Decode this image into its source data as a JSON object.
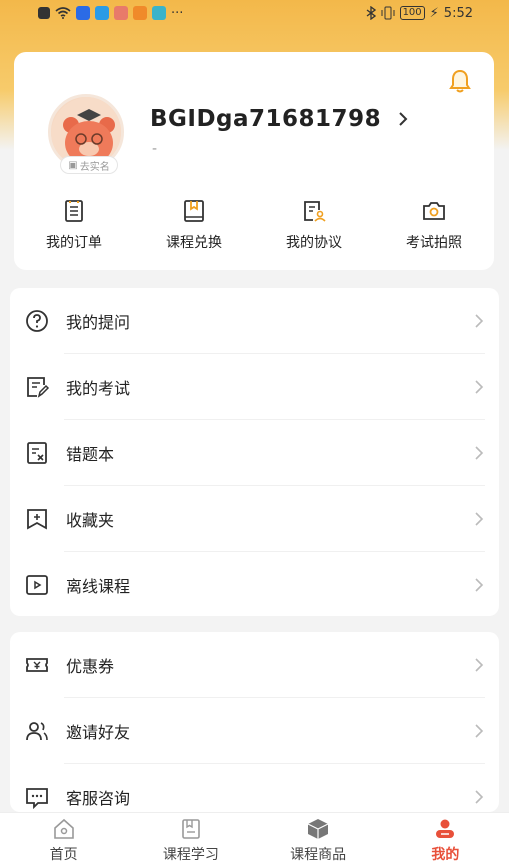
{
  "status_bar": {
    "time": "5:52",
    "battery": "100"
  },
  "profile": {
    "username": "BGIDga71681798",
    "subtitle": "-",
    "auth_badge": "去实名"
  },
  "quick_actions": [
    {
      "label": "我的订单",
      "icon": "order-icon"
    },
    {
      "label": "课程兑换",
      "icon": "book-icon"
    },
    {
      "label": "我的协议",
      "icon": "agreement-icon"
    },
    {
      "label": "考试拍照",
      "icon": "camera-icon"
    }
  ],
  "menu_group_1": [
    {
      "label": "我的提问",
      "icon": "question-icon"
    },
    {
      "label": "我的考试",
      "icon": "exam-icon"
    },
    {
      "label": "错题本",
      "icon": "wrong-book-icon"
    },
    {
      "label": "收藏夹",
      "icon": "bookmark-icon"
    },
    {
      "label": "离线课程",
      "icon": "video-icon"
    }
  ],
  "menu_group_2": [
    {
      "label": "优惠券",
      "icon": "coupon-icon"
    },
    {
      "label": "邀请好友",
      "icon": "invite-icon"
    },
    {
      "label": "客服咨询",
      "icon": "chat-icon"
    }
  ],
  "tabs": [
    {
      "label": "首页",
      "icon": "home-icon"
    },
    {
      "label": "课程学习",
      "icon": "study-icon"
    },
    {
      "label": "课程商品",
      "icon": "product-icon"
    },
    {
      "label": "我的",
      "icon": "profile-icon",
      "active": true
    }
  ],
  "colors": {
    "accent": "#e8503a",
    "header": "#f3b84a",
    "bell": "#f0a020"
  }
}
